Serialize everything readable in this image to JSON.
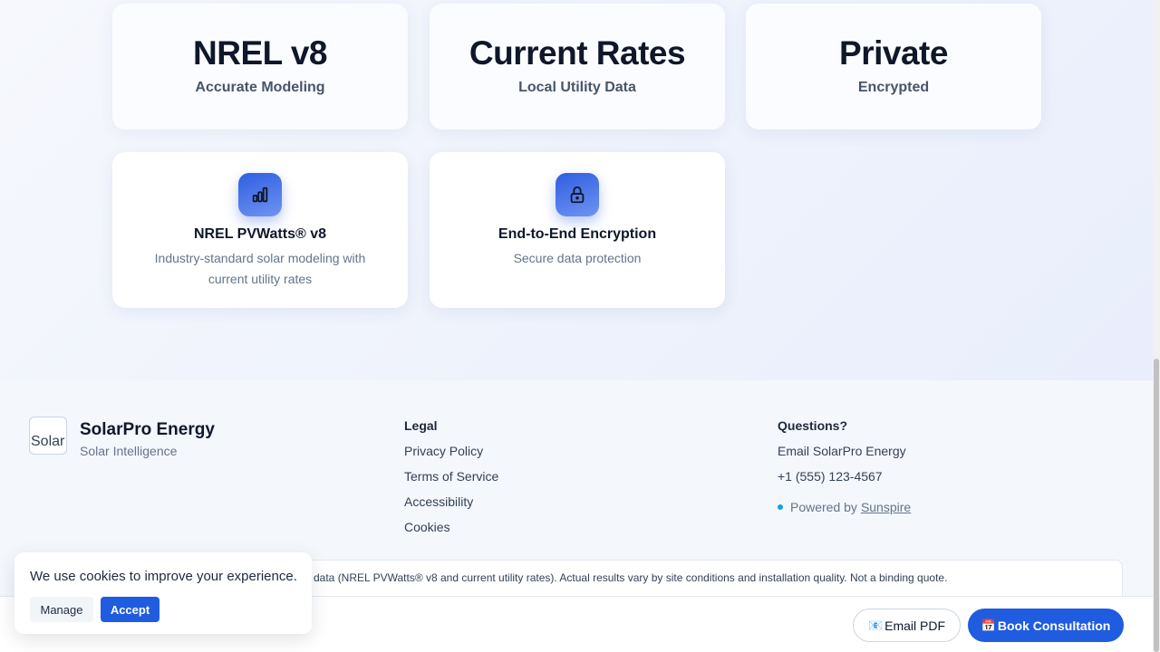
{
  "stats": [
    {
      "value": "NREL v8",
      "label": "Accurate Modeling"
    },
    {
      "value": "Current Rates",
      "label": "Local Utility Data"
    },
    {
      "value": "Private",
      "label": "Encrypted"
    }
  ],
  "features": [
    {
      "icon": "bar-chart-icon",
      "title": "NREL PVWatts® v8",
      "desc": "Industry-standard solar modeling with current utility rates"
    },
    {
      "icon": "lock-icon",
      "title": "End-to-End Encryption",
      "desc": "Secure data protection"
    }
  ],
  "footer": {
    "brand_name": "SolarPro Energy",
    "brand_tagline": "Solar Intelligence",
    "logo_alt": "Solar",
    "legal_heading": "Legal",
    "legal_links": [
      "Privacy Policy",
      "Terms of Service",
      "Accessibility",
      "Cookies"
    ],
    "questions_heading": "Questions?",
    "email_link": "Email SolarPro Energy",
    "phone": "+1 (555) 123-4567",
    "powered_prefix": "Powered by",
    "powered_link": "Sunspire"
  },
  "disclaimer": "data (NREL PVWatts® v8 and current utility rates). Actual results vary by site conditions and installation quality. Not a binding quote.",
  "actions": {
    "email_icon": "📧",
    "email_label": "Email PDF",
    "book_icon": "📅",
    "book_label": "Book Consultation"
  },
  "cookie": {
    "text": "We use cookies to improve your experience.",
    "manage_label": "Manage",
    "accept_label": "Accept"
  },
  "colors": {
    "accent": "#1f5ce0",
    "heading": "#0f172a",
    "muted": "#64748b"
  }
}
